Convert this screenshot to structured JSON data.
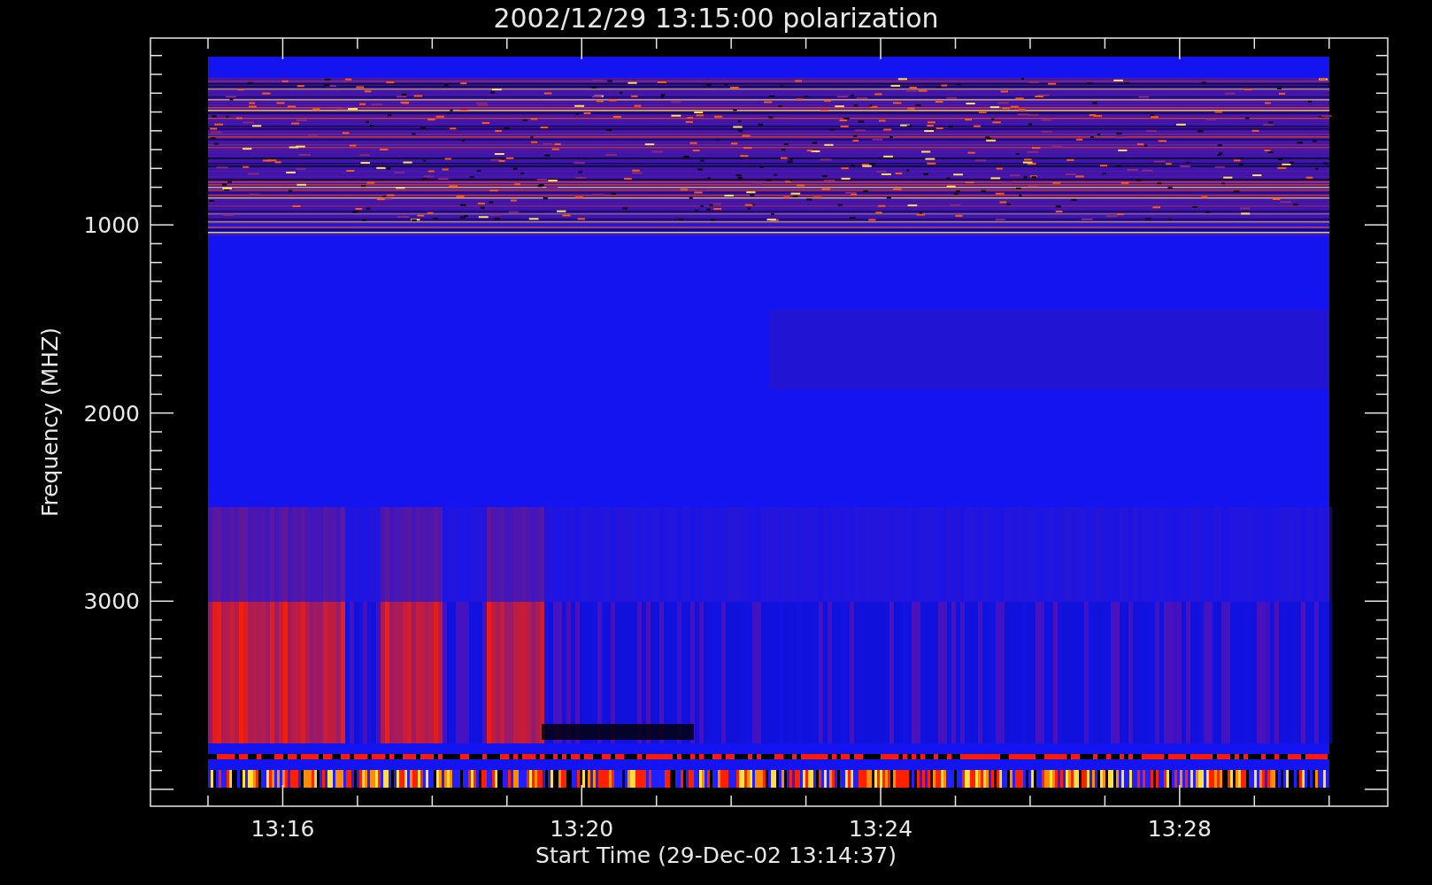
{
  "title": "2002/12/29 13:15:00 polarization",
  "xlabel": "Start Time (29-Dec-02 13:14:37)",
  "ylabel": "Frequency (MHZ)",
  "xticks": [
    "13:16",
    "13:20",
    "13:24",
    "13:28"
  ],
  "yticks": [
    "1000",
    "2000",
    "3000"
  ]
}
